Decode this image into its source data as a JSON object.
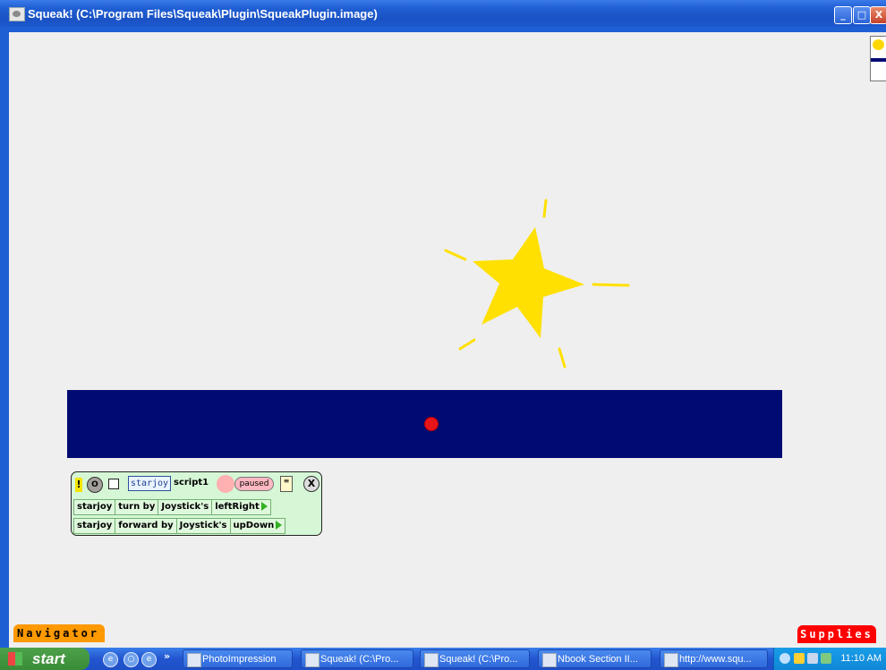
{
  "window": {
    "title": "Squeak! (C:\\Program Files\\Squeak\\Plugin\\SqueakPlugin.image)",
    "minimize_label": "_",
    "maximize_label": "□",
    "close_label": "X"
  },
  "world": {
    "background_color": "#efefef",
    "playfield_color": "#000a73",
    "ball_color": "#e8141a",
    "star_color": "#ffe000"
  },
  "scriptor": {
    "bang_label": "!",
    "clock_label": "O",
    "player_name": "starjoy",
    "script_name": "script1",
    "status": "paused",
    "close_label": "X",
    "rows": [
      {
        "tiles": [
          "starjoy",
          "turn by",
          "Joystick's",
          "leftRight"
        ]
      },
      {
        "tiles": [
          "starjoy",
          "forward by",
          "Joystick's",
          "upDown"
        ]
      }
    ]
  },
  "flaps": {
    "navigator": "Navigator",
    "supplies": "Supplies"
  },
  "taskbar": {
    "start_label": "start",
    "overflow": "»",
    "tasks": [
      {
        "label": "PhotoImpression"
      },
      {
        "label": "Squeak! (C:\\Pro..."
      },
      {
        "label": "Squeak! (C:\\Pro..."
      },
      {
        "label": "Nbook Section II..."
      },
      {
        "label": "http://www.squ..."
      }
    ],
    "clock": "11:10 AM"
  }
}
